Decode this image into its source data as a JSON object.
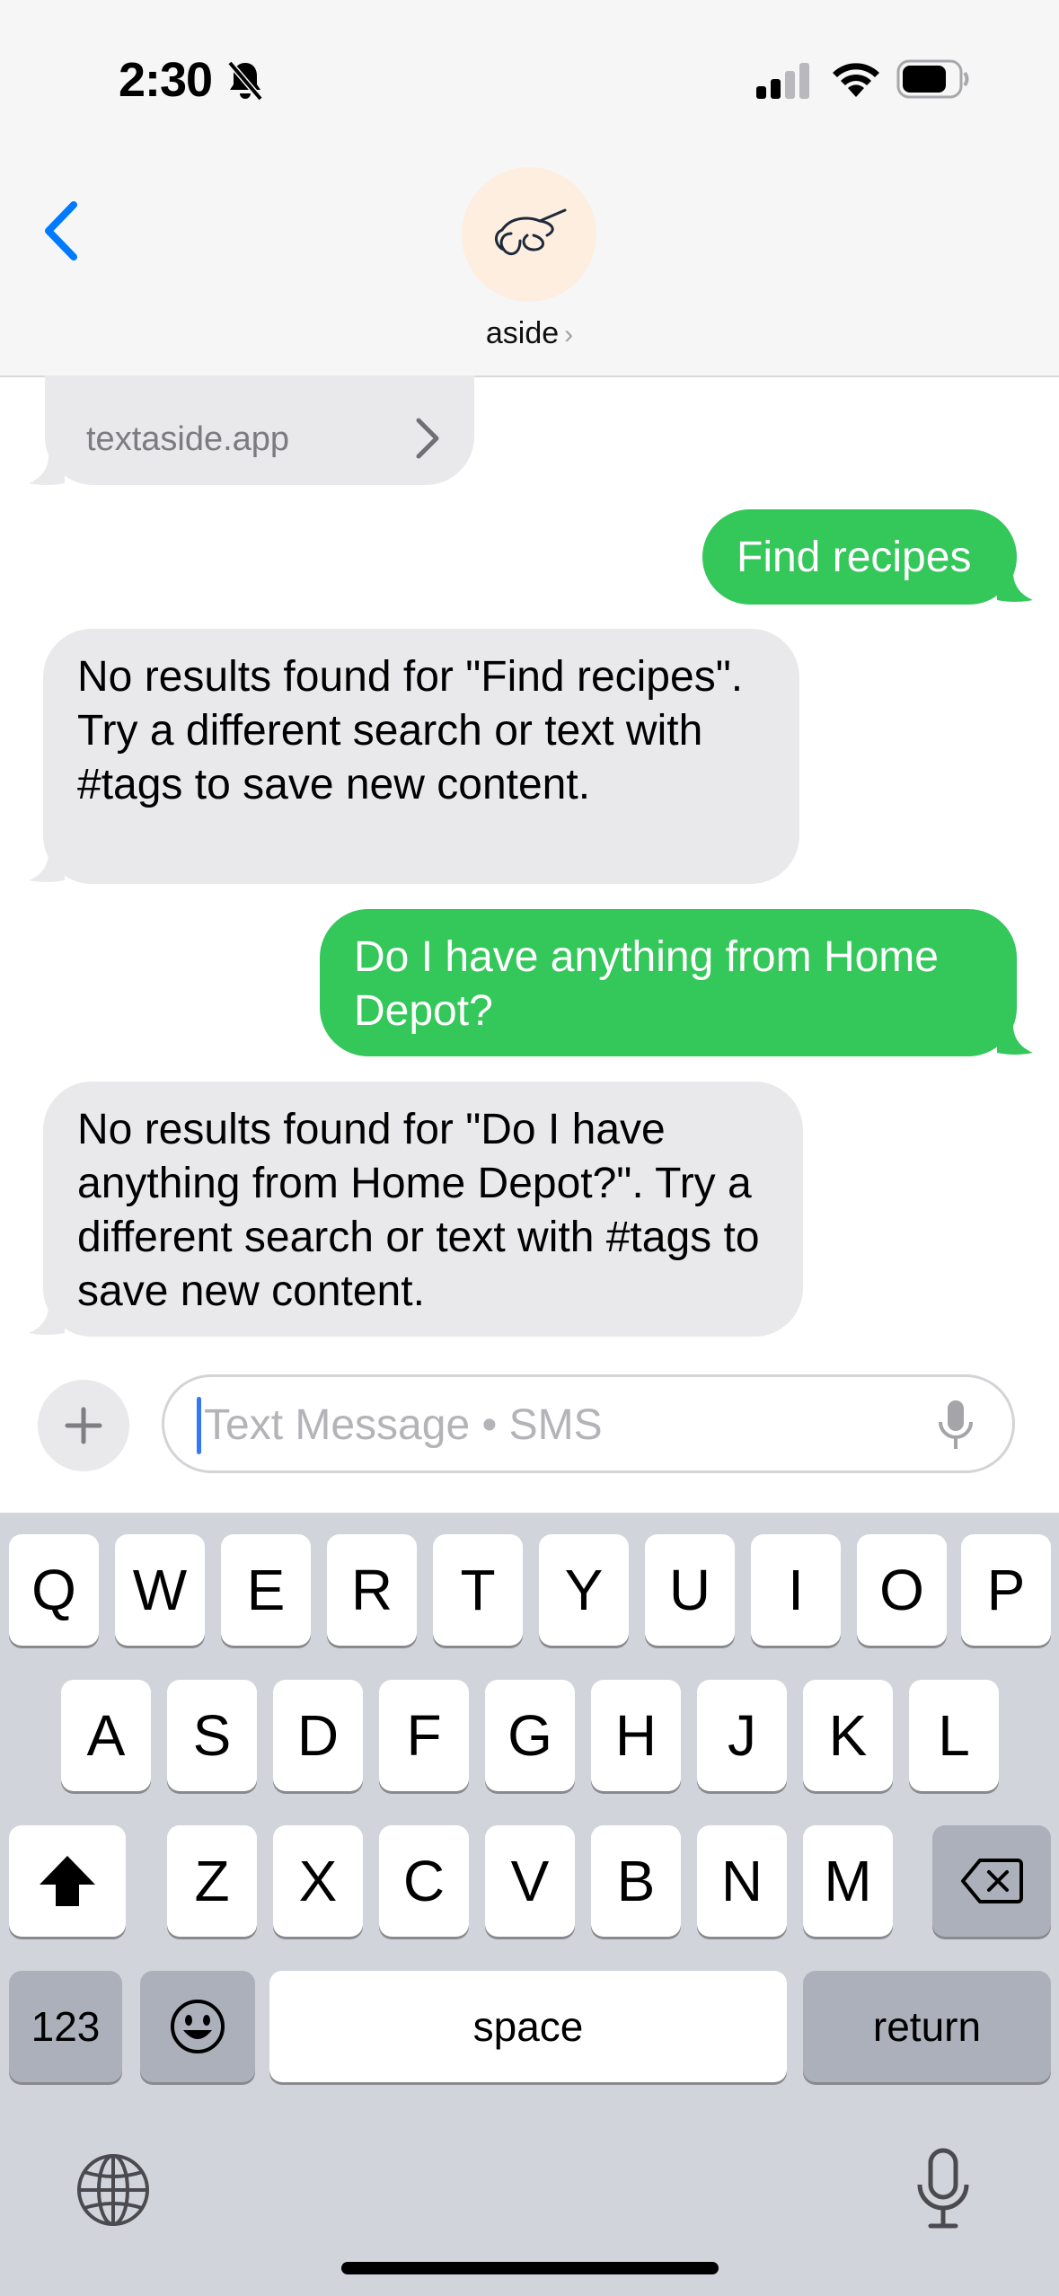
{
  "status_bar": {
    "time": "2:30"
  },
  "header": {
    "contact_name": "aside",
    "contact_chevron": "›"
  },
  "link_preview": {
    "domain": "textaside.app"
  },
  "messages": [
    {
      "direction": "outgoing",
      "text": "Find recipes"
    },
    {
      "direction": "incoming",
      "text": "No results found for \"Find recipes\". Try a different search or text with #tags to save new content."
    },
    {
      "direction": "outgoing",
      "text": "Do I have anything from Home Depot?"
    },
    {
      "direction": "incoming",
      "text": "No results found for \"Do I have anything from Home Depot?\". Try a different search or text with #tags to save new content."
    }
  ],
  "composer": {
    "placeholder": "Text Message • SMS",
    "plus_label": "+"
  },
  "keyboard": {
    "row1": [
      "Q",
      "W",
      "E",
      "R",
      "T",
      "Y",
      "U",
      "I",
      "O",
      "P"
    ],
    "row2": [
      "A",
      "S",
      "D",
      "F",
      "G",
      "H",
      "J",
      "K",
      "L"
    ],
    "row3": [
      "Z",
      "X",
      "C",
      "V",
      "B",
      "N",
      "M"
    ],
    "numbers_label": "123",
    "space_label": "space",
    "return_label": "return"
  },
  "colors": {
    "outgoing_bubble": "#34c759",
    "incoming_bubble": "#e9e9eb",
    "accent": "#007aff",
    "keyboard_bg": "#d1d4db"
  }
}
